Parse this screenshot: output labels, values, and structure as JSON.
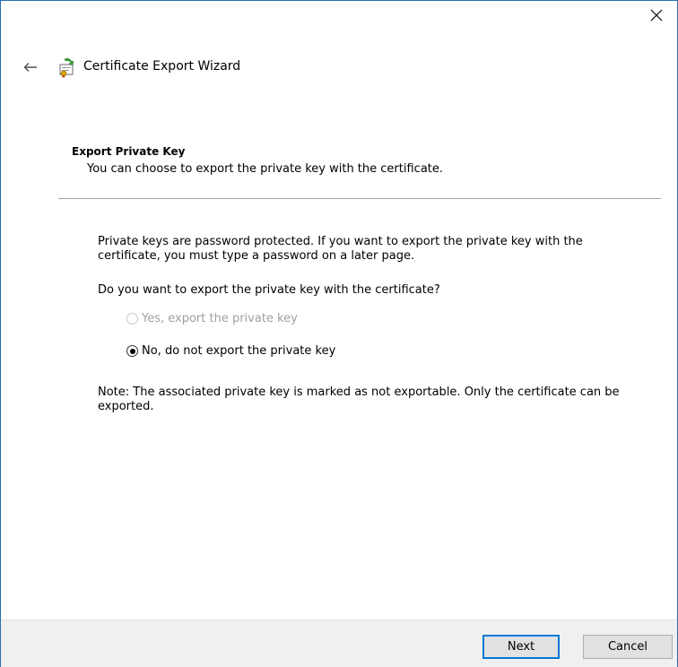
{
  "window": {
    "title": "Certificate Export Wizard"
  },
  "page": {
    "heading": "Export Private Key",
    "subtitle": "You can choose to export the private key with the certificate."
  },
  "content": {
    "info_text": "Private keys are password protected. If you want to export the private key with the certificate, you must type a password on a later page.",
    "question": "Do you want to export the private key with the certificate?",
    "options": [
      {
        "label": "Yes, export the private key",
        "checked": false,
        "enabled": false
      },
      {
        "label": "No, do not export the private key",
        "checked": true,
        "enabled": true
      }
    ],
    "note": "Note: The associated private key is marked as not exportable. Only the certificate can be exported."
  },
  "buttons": {
    "next": "Next",
    "cancel": "Cancel"
  },
  "icons": {
    "close": "close-icon",
    "back": "back-arrow-icon",
    "wizard": "certificate-wizard-icon"
  },
  "colors": {
    "window_border": "#2b6cb0",
    "footer_bg": "#f0f0f0",
    "default_button_border": "#0078d7",
    "disabled_text": "#a0a0a0"
  }
}
